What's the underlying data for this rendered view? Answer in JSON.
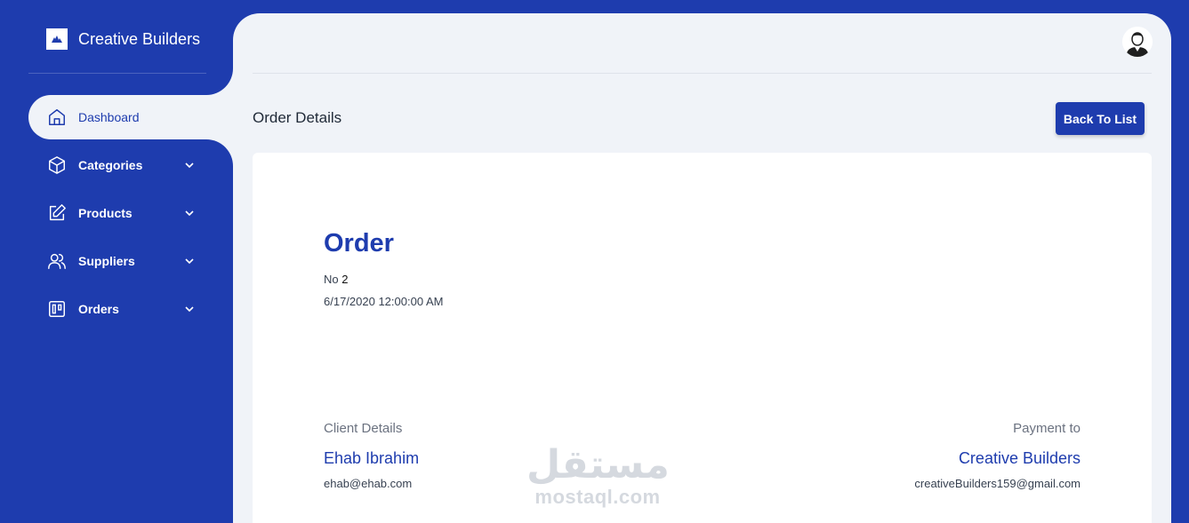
{
  "brand": {
    "name": "Creative Builders"
  },
  "sidebar": {
    "items": [
      {
        "label": "Dashboard",
        "icon": "home-icon",
        "active": true
      },
      {
        "label": "Categories",
        "icon": "box-icon",
        "expandable": true
      },
      {
        "label": "Products",
        "icon": "edit-icon",
        "expandable": true
      },
      {
        "label": "Suppliers",
        "icon": "users-icon",
        "expandable": true
      },
      {
        "label": "Orders",
        "icon": "kanban-icon",
        "expandable": true
      }
    ]
  },
  "header": {
    "title": "Order Details",
    "back_label": "Back To List"
  },
  "order": {
    "title": "Order",
    "no_label": "No",
    "no_value": "2",
    "date": "6/17/2020 12:00:00 AM"
  },
  "client": {
    "section_label": "Client Details",
    "name": "Ehab Ibrahim",
    "email": "ehab@ehab.com"
  },
  "payment": {
    "section_label": "Payment to",
    "name": "Creative Builders",
    "email": "creativeBuilders159@gmail.com"
  },
  "watermark": {
    "arabic": "مستقل",
    "latin": "mostaql.com"
  },
  "colors": {
    "primary": "#1e3cae",
    "background": "#f0f3f8",
    "card": "#ffffff"
  }
}
